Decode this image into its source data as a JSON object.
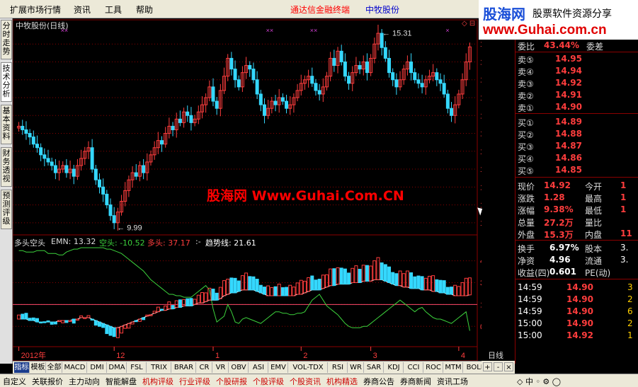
{
  "menu": {
    "items": [
      "扩展市场行情",
      "资讯",
      "工具",
      "帮助"
    ],
    "terminal_title": "通达信金融终端",
    "stock_title": "中牧股份"
  },
  "logo": {
    "name": "股海网",
    "slogan": "股票软件资源分享",
    "url": "www.Guhai.com.cn"
  },
  "left_tabs": [
    "分时走势",
    "技术分析",
    "基本资料",
    "财务透视",
    "预测评级"
  ],
  "main_chart": {
    "title": "中牧股份(日线)",
    "high_label": "15.31",
    "low_label": "9.99"
  },
  "watermark": "股海网 Www.Guhai.Com.CN",
  "indicator": {
    "name": "多头空头",
    "emn_label": "EMN: 13.32",
    "kong_label": "空头: -10.52",
    "duo_label": "多头: 37.17",
    "sep": ":-",
    "trend_label": "趋势线: 21.61"
  },
  "period_label": "日线",
  "corner": "◇ ⊟",
  "colors": {
    "up": "#ff3d3d",
    "down": "#35d8ff",
    "grid": "#8b0000",
    "white_line": "#ffffff",
    "green_line": "#3cd23c",
    "axis_label": "#ff3d3d"
  },
  "quote": {
    "weibi_label": "委比",
    "weibi_value": "43.44%",
    "weicha_label": "委差",
    "sells": [
      {
        "label": "卖⑤",
        "price": "14.95"
      },
      {
        "label": "卖④",
        "price": "14.94"
      },
      {
        "label": "卖③",
        "price": "14.92"
      },
      {
        "label": "卖②",
        "price": "14.91"
      },
      {
        "label": "卖①",
        "price": "14.90"
      }
    ],
    "buys": [
      {
        "label": "买①",
        "price": "14.89"
      },
      {
        "label": "买②",
        "price": "14.88"
      },
      {
        "label": "买③",
        "price": "14.87"
      },
      {
        "label": "买④",
        "price": "14.86"
      },
      {
        "label": "买⑤",
        "price": "14.85"
      }
    ],
    "stats": [
      {
        "l1": "现价",
        "v1": "14.92",
        "l2": "今开",
        "v2": "1"
      },
      {
        "l1": "涨跌",
        "v1": "1.28",
        "l2": "最高",
        "v2": "1"
      },
      {
        "l1": "涨幅",
        "v1": "9.38%",
        "l2": "最低",
        "v2": "1"
      },
      {
        "l1": "总量",
        "v1": "27.2万",
        "l2": "量比",
        "v2": ""
      },
      {
        "l1": "外盘",
        "v1": "15.3万",
        "l2": "内盘",
        "v2": "11"
      }
    ],
    "stats2": [
      {
        "l1": "换手",
        "v1": "6.97%",
        "l2": "股本",
        "v2": "3."
      },
      {
        "l1": "净资",
        "v1": "4.96",
        "l2": "流通",
        "v2": "3."
      },
      {
        "l1": "收益(四)",
        "v1": "0.601",
        "l2": "PE(动)",
        "v2": ""
      }
    ],
    "ticks": [
      {
        "time": "14:59",
        "price": "14.90",
        "vol": "3"
      },
      {
        "time": "14:59",
        "price": "14.90",
        "vol": "2"
      },
      {
        "time": "14:59",
        "price": "14.90",
        "vol": "6"
      },
      {
        "time": "15:00",
        "price": "14.90",
        "vol": "2"
      },
      {
        "time": "15:00",
        "price": "14.92",
        "vol": "1"
      }
    ]
  },
  "indicator_tabs": [
    "指标",
    "模板",
    "全部",
    "MACD",
    "DMI",
    "DMA",
    "FSL",
    "TRIX",
    "BRAR",
    "CR",
    "VR",
    "OBV",
    "ASI",
    "EMV",
    "VOL-TDX",
    "RSI",
    "WR",
    "SAR",
    "KDJ",
    "CCI",
    "ROC",
    "MTM",
    "BOLL"
  ],
  "nav_buttons": [
    "+",
    "-",
    "×"
  ],
  "bottom_tabs": [
    "自定义",
    "关联报价",
    "主力动向",
    "智能解盘",
    "机构评级",
    "行业评级",
    "个股研报",
    "个股评级",
    "个股资讯",
    "机构精选",
    "券商公告",
    "券商新闻",
    "资讯工场"
  ],
  "bottom_right": "◇ 中 ◦ ⚙ ◯",
  "chart_data": {
    "type": "candlestick",
    "x_labels": [
      {
        "label": "2012年",
        "i": 0
      },
      {
        "label": "12",
        "i": 26
      },
      {
        "label": "1",
        "i": 53
      },
      {
        "label": "2",
        "i": 77
      },
      {
        "label": "3",
        "i": 96
      },
      {
        "label": "4",
        "i": 120
      }
    ],
    "price_ticks": [
      10.0,
      10.5,
      11.0,
      11.5,
      12.0,
      12.5,
      13.0,
      13.5,
      14.0,
      14.5,
      15.0
    ],
    "price_range": [
      9.7,
      15.4
    ],
    "ind_ticks": [
      0,
      15,
      30,
      45
    ],
    "ind_range": [
      -12,
      55
    ],
    "closes": [
      12.7,
      12.6,
      12.5,
      12.4,
      12.2,
      12.1,
      11.9,
      11.8,
      11.7,
      11.6,
      11.4,
      11.5,
      11.6,
      11.4,
      11.5,
      11.3,
      11.6,
      11.8,
      12.0,
      12.1,
      11.5,
      11.2,
      11.0,
      10.8,
      10.5,
      10.2,
      10.0,
      10.3,
      10.6,
      10.9,
      11.2,
      11.4,
      11.3,
      11.6,
      11.4,
      11.7,
      11.9,
      12.1,
      12.3,
      12.2,
      12.5,
      12.7,
      12.6,
      12.9,
      12.8,
      13.1,
      13.0,
      12.8,
      12.9,
      13.1,
      13.3,
      13.5,
      13.8,
      13.4,
      13.2,
      13.7,
      14.1,
      14.6,
      14.3,
      14.0,
      13.8,
      14.2,
      14.4,
      14.3,
      14.0,
      13.6,
      13.3,
      13.0,
      13.2,
      13.4,
      13.3,
      13.5,
      13.4,
      13.2,
      13.3,
      13.5,
      13.7,
      13.9,
      14.0,
      14.1,
      13.9,
      13.7,
      13.6,
      13.8,
      14.1,
      14.6,
      14.4,
      14.8,
      14.5,
      14.1,
      13.9,
      14.2,
      14.4,
      14.3,
      14.5,
      14.2,
      14.6,
      15.0,
      15.3,
      14.9,
      14.6,
      14.2,
      14.0,
      13.8,
      14.0,
      14.3,
      14.5,
      14.2,
      14.0,
      13.9,
      13.8,
      14.0,
      14.1,
      14.2,
      14.0,
      13.9,
      13.6,
      13.2,
      13.0,
      13.3,
      13.6,
      14.0,
      14.5,
      14.92
    ],
    "trend_line": [
      5,
      5,
      5,
      4,
      4,
      3,
      3,
      3,
      3,
      3,
      3,
      4,
      4,
      4,
      4,
      5,
      5,
      6,
      6,
      6,
      5,
      4,
      3,
      2,
      1,
      0,
      -1,
      -1,
      0,
      1,
      2,
      3,
      4,
      5,
      6,
      7,
      8,
      9,
      10,
      11,
      11,
      12,
      12,
      13,
      13,
      14,
      14,
      14,
      15,
      16,
      16,
      17,
      18,
      18,
      18,
      19,
      21,
      22,
      23,
      23,
      24,
      25,
      25,
      25,
      25,
      24,
      23,
      22,
      21,
      21,
      21,
      21,
      21,
      21,
      21,
      21,
      22,
      22,
      23,
      24,
      25,
      25,
      25,
      26,
      27,
      28,
      28,
      29,
      29,
      29,
      29,
      30,
      30,
      30,
      31,
      31,
      31,
      32,
      32,
      32,
      31,
      30,
      29,
      28,
      28,
      27,
      27,
      26,
      26,
      26,
      25,
      25,
      25,
      24,
      24,
      23,
      23,
      22,
      22,
      21,
      21,
      21,
      21,
      21.6
    ],
    "emn_line": [
      52,
      52,
      51,
      51,
      51,
      52,
      52,
      52,
      50,
      50,
      50,
      49,
      49,
      51,
      52,
      53,
      53,
      54,
      54,
      54,
      54,
      54,
      54,
      54,
      53,
      53,
      52,
      51,
      50,
      48,
      46,
      44,
      42,
      40,
      38,
      35,
      32,
      30,
      28,
      26,
      24,
      22,
      22,
      21,
      21,
      20,
      20,
      20,
      22,
      24,
      26,
      28,
      25,
      12,
      3,
      5,
      7,
      15,
      10,
      3,
      2,
      5,
      6,
      5,
      4,
      3,
      2,
      4,
      6,
      8,
      10,
      10,
      9,
      9,
      8,
      8,
      9,
      9,
      10,
      14,
      18,
      20,
      22,
      18,
      14,
      12,
      10,
      8,
      5,
      2,
      0,
      -1,
      -1,
      -1,
      0,
      0,
      2,
      4,
      6,
      8,
      10,
      12,
      14,
      16,
      18,
      16,
      14,
      12,
      10,
      12,
      13,
      10,
      8,
      6,
      5,
      5,
      4,
      3,
      2,
      4,
      6,
      8,
      10,
      -3
    ]
  }
}
